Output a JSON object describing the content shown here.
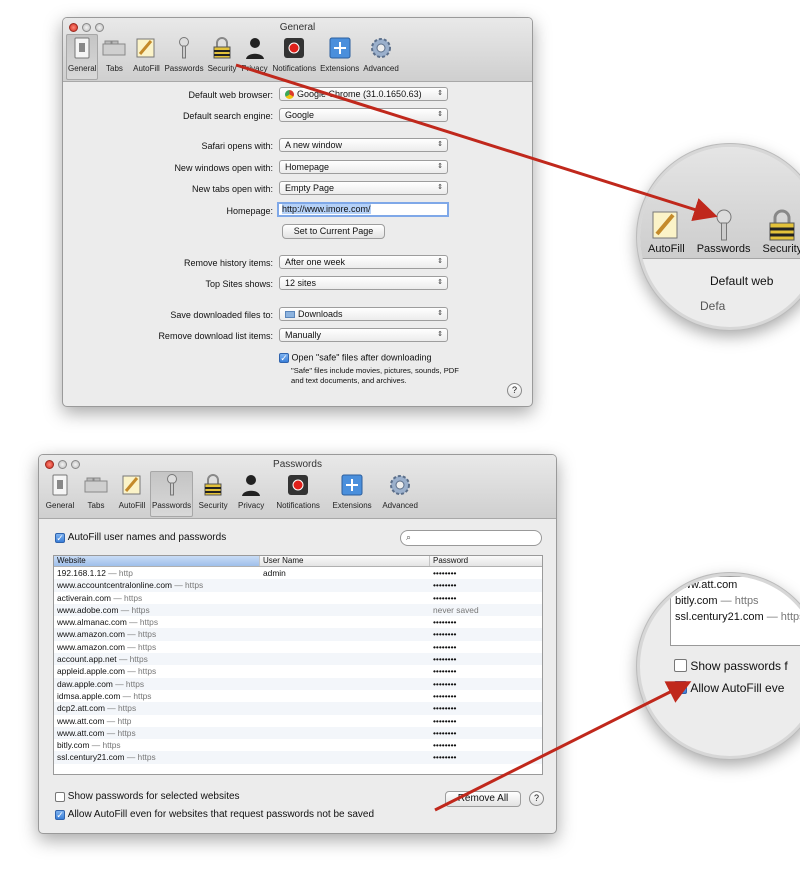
{
  "general_window": {
    "title": "General",
    "toolbar": [
      {
        "label": "General",
        "icon": "general-icon"
      },
      {
        "label": "Tabs",
        "icon": "tabs-icon"
      },
      {
        "label": "AutoFill",
        "icon": "autofill-icon"
      },
      {
        "label": "Passwords",
        "icon": "key-icon"
      },
      {
        "label": "Security",
        "icon": "lock-icon"
      },
      {
        "label": "Privacy",
        "icon": "privacy-icon"
      },
      {
        "label": "Notifications",
        "icon": "notifications-icon"
      },
      {
        "label": "Extensions",
        "icon": "extensions-icon"
      },
      {
        "label": "Advanced",
        "icon": "gear-icon"
      }
    ],
    "default_browser_label": "Default web browser:",
    "default_browser_value": "Google Chrome (31.0.1650.63)",
    "search_engine_label": "Default search engine:",
    "search_engine_value": "Google",
    "opens_with_label": "Safari opens with:",
    "opens_with_value": "A new window",
    "new_windows_label": "New windows open with:",
    "new_windows_value": "Homepage",
    "new_tabs_label": "New tabs open with:",
    "new_tabs_value": "Empty Page",
    "homepage_label": "Homepage:",
    "homepage_value": "http://www.imore.com/",
    "set_current_button": "Set to Current Page",
    "history_label": "Remove history items:",
    "history_value": "After one week",
    "top_sites_label": "Top Sites shows:",
    "top_sites_value": "12 sites",
    "download_to_label": "Save downloaded files to:",
    "download_to_value": "Downloads",
    "download_list_label": "Remove download list items:",
    "download_list_value": "Manually",
    "open_safe_label": "Open \"safe\" files after downloading",
    "open_safe_note": "\"Safe\" files include movies, pictures, sounds, PDF and text documents, and archives.",
    "help": "?"
  },
  "passwords_window": {
    "title": "Passwords",
    "autofill_label": "AutoFill user names and passwords",
    "search_placeholder": "",
    "columns": [
      "Website",
      "User Name",
      "Password"
    ],
    "rows": [
      {
        "site": "192.168.1.12",
        "proto": "— http",
        "user": "admin",
        "password": "••••••••"
      },
      {
        "site": "www.accountcentralonline.com",
        "proto": "— https",
        "user": "",
        "password": "••••••••"
      },
      {
        "site": "activerain.com",
        "proto": "— https",
        "user": "",
        "password": "••••••••"
      },
      {
        "site": "www.adobe.com",
        "proto": "— https",
        "user": "",
        "password": "never saved"
      },
      {
        "site": "www.almanac.com",
        "proto": "— https",
        "user": "",
        "password": "••••••••"
      },
      {
        "site": "www.amazon.com",
        "proto": "— https",
        "user": "",
        "password": "••••••••"
      },
      {
        "site": "www.amazon.com",
        "proto": "— https",
        "user": "",
        "password": "••••••••"
      },
      {
        "site": "account.app.net",
        "proto": "— https",
        "user": "",
        "password": "••••••••"
      },
      {
        "site": "appleid.apple.com",
        "proto": "— https",
        "user": "",
        "password": "••••••••"
      },
      {
        "site": "daw.apple.com",
        "proto": "— https",
        "user": "",
        "password": "••••••••"
      },
      {
        "site": "idmsa.apple.com",
        "proto": "— https",
        "user": "",
        "password": "••••••••"
      },
      {
        "site": "dcp2.att.com",
        "proto": "— https",
        "user": "",
        "password": "••••••••"
      },
      {
        "site": "www.att.com",
        "proto": "— http",
        "user": "",
        "password": "••••••••"
      },
      {
        "site": "www.att.com",
        "proto": "— https",
        "user": "",
        "password": "••••••••"
      },
      {
        "site": "bitly.com",
        "proto": "— https",
        "user": "",
        "password": "••••••••"
      },
      {
        "site": "ssl.century21.com",
        "proto": "— https",
        "user": "",
        "password": "••••••••"
      }
    ],
    "show_passwords_label": "Show passwords for selected websites",
    "allow_autofill_label": "Allow AutoFill even for websites that request passwords not be saved",
    "remove_all_button": "Remove All",
    "help": "?"
  },
  "zoom_top": {
    "items": [
      "AutoFill",
      "Passwords",
      "Security"
    ],
    "text1": "Default web",
    "text2": "Defa"
  },
  "zoom_bottom": {
    "rows": [
      {
        "site": "www.att.com",
        "proto": ""
      },
      {
        "site": "bitly.com",
        "proto": "— https"
      },
      {
        "site": "ssl.century21.com",
        "proto": "— https"
      }
    ],
    "show_label": "Show passwords f",
    "allow_label": "Allow AutoFill eve"
  },
  "colors": {
    "arrow": "#c0281c",
    "selection": "#b5d1f7",
    "window_bg": "#ececec"
  }
}
